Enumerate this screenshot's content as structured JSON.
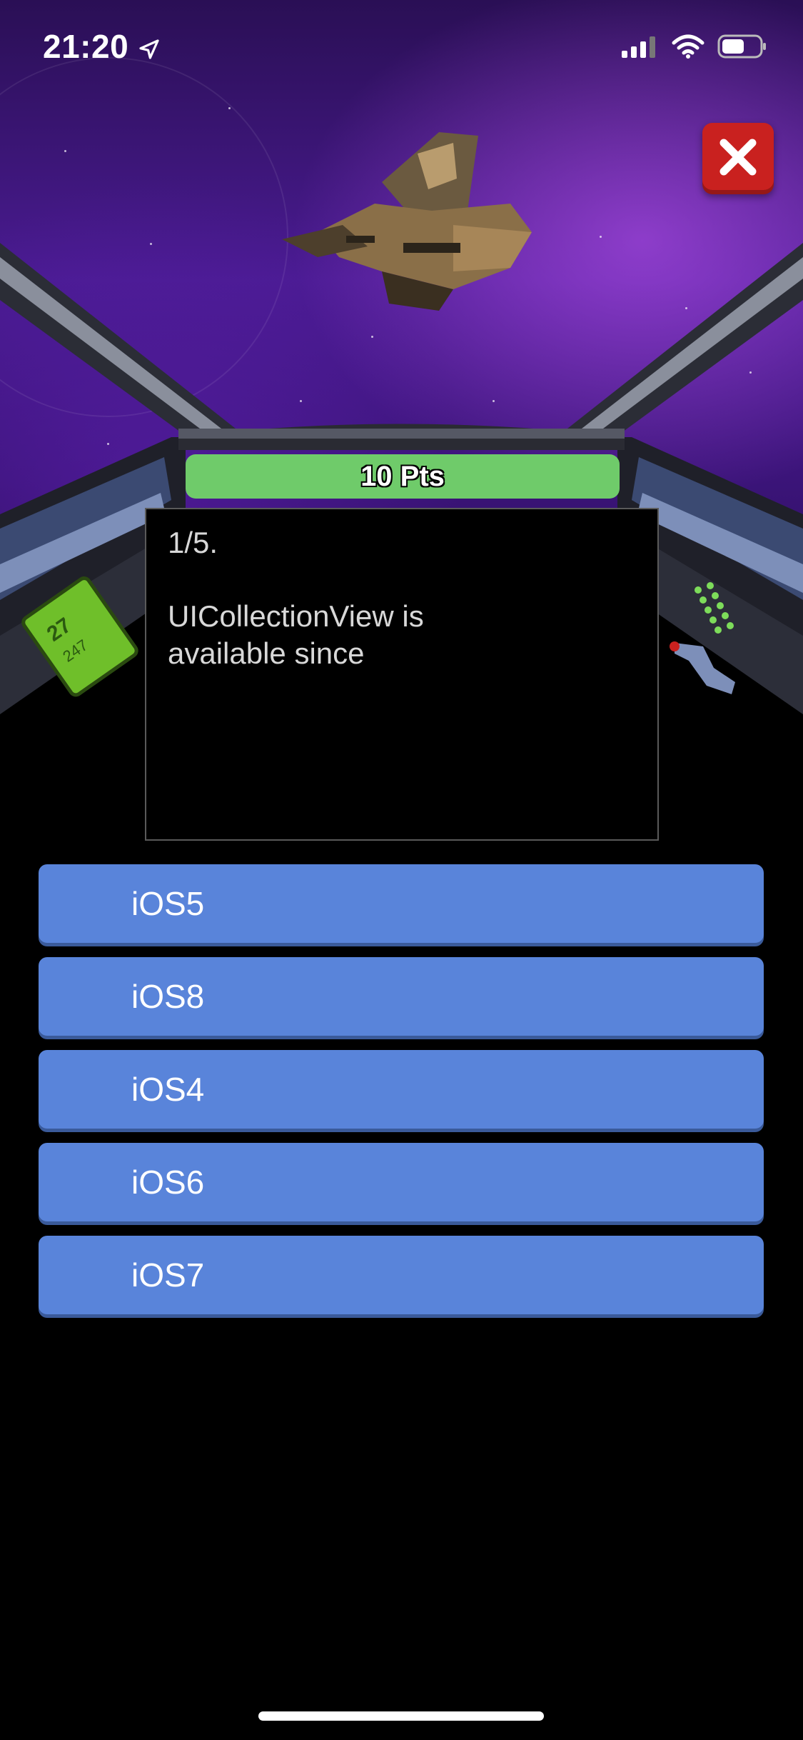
{
  "status_bar": {
    "time": "21:20",
    "icons": [
      "location-arrow-icon",
      "cellular-signal-icon",
      "wifi-icon",
      "battery-icon"
    ]
  },
  "close_button": {
    "icon": "close-icon",
    "color": "#c9211f"
  },
  "score": {
    "label": "10 Pts",
    "color": "#6fcb6a"
  },
  "question": {
    "number": "1/5.",
    "text": "UICollectionView is available since"
  },
  "answers": [
    {
      "label": "iOS5"
    },
    {
      "label": "iOS8"
    },
    {
      "label": "iOS4"
    },
    {
      "label": "iOS6"
    },
    {
      "label": "iOS7"
    }
  ],
  "colors": {
    "answer_button": "#5984da",
    "background": "#000000",
    "sky": "#4a1b92"
  }
}
